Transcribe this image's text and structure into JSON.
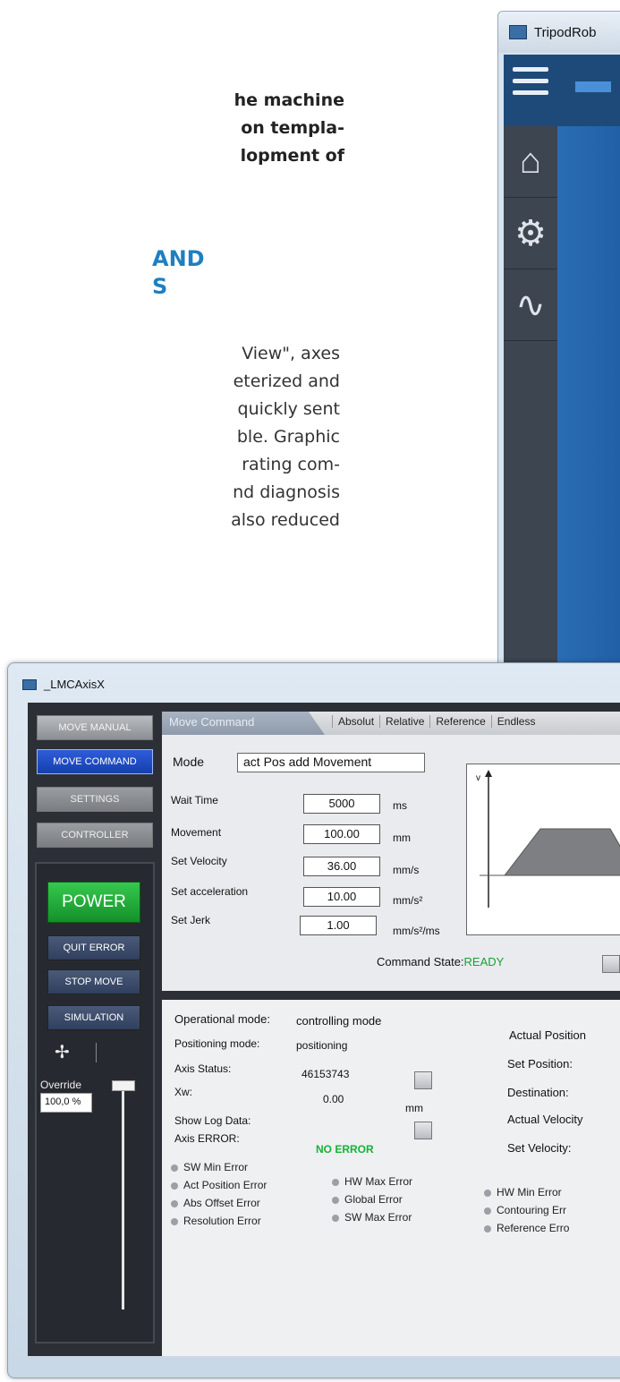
{
  "article": {
    "intro_lines": [
      "he machine",
      "on templa-",
      "lopment of"
    ],
    "heading_lines": [
      "AND",
      "S"
    ],
    "body_lines": [
      " View\", axes",
      "eterized  and",
      "quickly  sent",
      "ble.  Graphic",
      "rating  com-",
      "nd  diagnosis",
      "also  reduced"
    ]
  },
  "tripod_window": {
    "title": "TripodRob"
  },
  "lmc_window": {
    "title": "_LMCAxisX",
    "menu": {
      "move_manual": "MOVE MANUAL",
      "move_command": "MOVE COMMAND",
      "settings": "SETTINGS",
      "controller": "CONTROLLER"
    },
    "controls": {
      "power": "POWER",
      "quit_error": "QUIT ERROR",
      "stop_move": "STOP MOVE",
      "simulation": "SIMULATION",
      "crosshair": "✢",
      "override_label": "Override",
      "override_value": "100,0 %"
    },
    "command": {
      "tab_active": "Move Command",
      "tabs": [
        "Absolut",
        "Relative",
        "Reference",
        "Endless"
      ],
      "mode_label": "Mode",
      "mode_value": "act Pos add Movement",
      "params": [
        {
          "label": "Wait Time",
          "value": "5000",
          "unit": "ms"
        },
        {
          "label": "Movement",
          "value": "100.00",
          "unit": "mm"
        },
        {
          "label": "Set Velocity",
          "value": "36.00",
          "unit": "mm/s"
        },
        {
          "label": "Set acceleration",
          "value": "10.00",
          "unit": "mm/s²"
        },
        {
          "label": "Set Jerk",
          "value": "1.00",
          "unit": "mm/s²/ms"
        }
      ],
      "graph_axis_label": "v",
      "command_state_label": "Command State:",
      "command_state_value": "READY"
    },
    "status": {
      "operational_mode_label": "Operational mode:",
      "operational_mode_value": "controlling mode",
      "positioning_mode_label": "Positioning mode:",
      "positioning_mode_value": "positioning",
      "axis_status_label": "Axis Status:",
      "axis_status_value": "46153743",
      "xw_label": "Xw:",
      "xw_value": "0.00",
      "xw_unit": "mm",
      "show_log_label": "Show Log Data:",
      "axis_error_label": "Axis ERROR:",
      "axis_error_value": "NO ERROR",
      "right_labels": [
        "Actual Position",
        "Set Position:",
        "Destination:",
        "Actual Velocity",
        "Set Velocity:"
      ],
      "errors_col1": [
        "SW Min Error",
        "Act Position Error",
        "Abs Offset Error",
        "Resolution Error"
      ],
      "errors_col2": [
        "HW Max Error",
        "Global Error",
        "SW Max Error"
      ],
      "errors_col3": [
        "HW Min Error",
        "Contouring Err",
        "Reference Erro"
      ]
    },
    "colors": {
      "power_green": "#14912a",
      "active_blue": "#153fb0",
      "ready_green": "#16a334",
      "panel_dark": "#2c3036"
    }
  }
}
